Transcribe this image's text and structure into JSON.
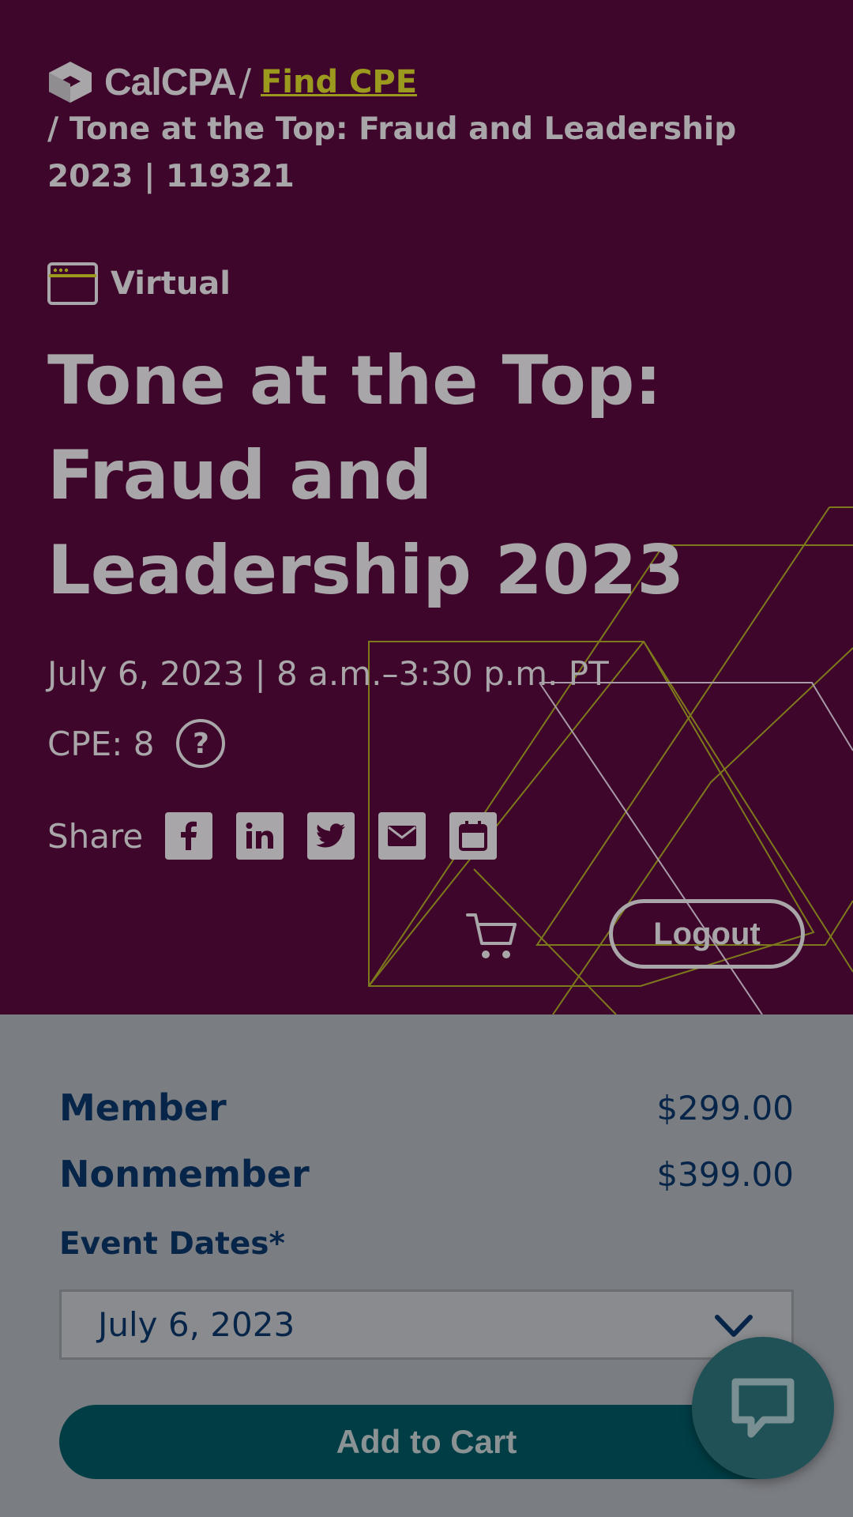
{
  "breadcrumb": {
    "logo_text": "CalCPA",
    "separator": "/",
    "link_label": "Find CPE",
    "current": "/ Tone at the Top: Fraud and Leadership 2023 | 119321"
  },
  "event": {
    "format_label": "Virtual",
    "format_icon": "browser-window-icon",
    "title": "Tone at the Top: Fraud and Leadership 2023",
    "datetime": "July 6, 2023 | 8 a.m.–3:30 p.m. PT",
    "cpe_label": "CPE: 8",
    "help_icon_glyph": "?"
  },
  "share": {
    "label": "Share",
    "icons": [
      "facebook-icon",
      "linkedin-icon",
      "twitter-icon",
      "email-icon",
      "calendar-icon"
    ]
  },
  "header_actions": {
    "cart_icon": "cart-icon",
    "logout_label": "Logout"
  },
  "pricing": {
    "rows": [
      {
        "name": "Member",
        "price": "$299.00"
      },
      {
        "name": "Nonmember",
        "price": "$399.00"
      }
    ]
  },
  "registration": {
    "dates_label": "Event Dates*",
    "selected_date": "July 6, 2023",
    "add_to_cart_label": "Add to Cart"
  },
  "chat": {
    "icon": "chat-bubble-icon"
  },
  "colors": {
    "hero_bg": "#3f062b",
    "accent_olive": "#9b9a1e",
    "text_navy": "#062548",
    "button_teal": "#003d45",
    "page_bg": "#7a7d82"
  }
}
